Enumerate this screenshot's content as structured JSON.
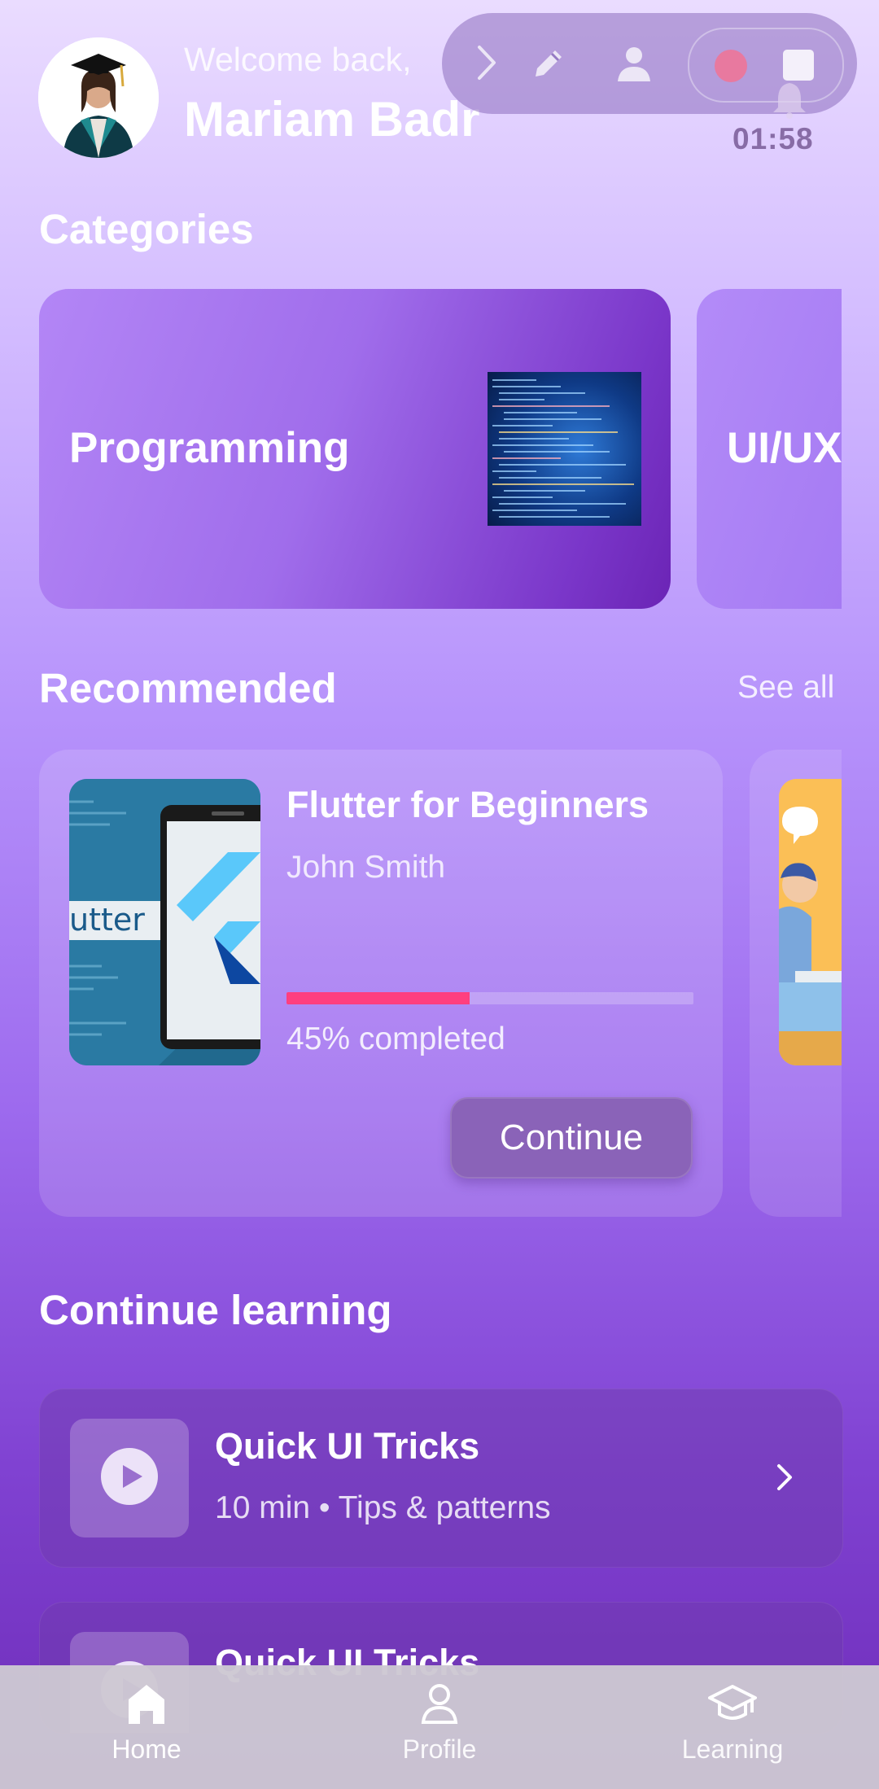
{
  "header": {
    "welcome_text": "Welcome back,",
    "user_name": "Mariam Badr",
    "timer": "01:58"
  },
  "overlay_toolbar": {
    "icons": [
      "chevron-right-icon",
      "pencil-icon",
      "person-icon",
      "record-dot-icon",
      "stop-square-icon"
    ]
  },
  "categories": {
    "title": "Categories",
    "items": [
      {
        "label": "Programming"
      },
      {
        "label": "UI/UX"
      }
    ]
  },
  "recommended": {
    "title": "Recommended",
    "see_all": "See all",
    "courses": [
      {
        "title": "Flutter for Beginners",
        "author": "John Smith",
        "progress": 0.45,
        "progress_text": "45% completed",
        "button_label": "Continue",
        "image_text": "utter"
      }
    ]
  },
  "continue_learning": {
    "title": "Continue learning",
    "items": [
      {
        "title": "Quick UI Tricks",
        "subtitle": "10 min • Tips & patterns"
      },
      {
        "title": "Quick UI Tricks",
        "subtitle": ""
      }
    ]
  },
  "bottom_nav": {
    "items": [
      {
        "label": "Home",
        "icon": "home-icon",
        "active": true
      },
      {
        "label": "Profile",
        "icon": "person-icon",
        "active": false
      },
      {
        "label": "Learning",
        "icon": "graduation-cap-icon",
        "active": false
      }
    ]
  },
  "colors": {
    "progress_fill": "#ff3f7f",
    "record_dot": "#e8799f",
    "accent_purple": "#7a36c9"
  }
}
